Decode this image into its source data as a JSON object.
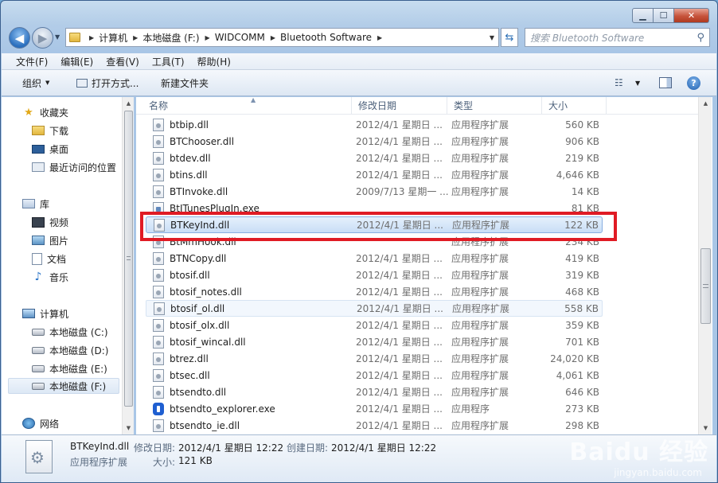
{
  "address": {
    "crumbs": [
      "计算机",
      "本地磁盘 (F:)",
      "WIDCOMM",
      "Bluetooth Software"
    ],
    "search_placeholder": "搜索 Bluetooth Software"
  },
  "menu": [
    "文件(F)",
    "编辑(E)",
    "查看(V)",
    "工具(T)",
    "帮助(H)"
  ],
  "toolbar": {
    "organize": "组织",
    "open_with": "打开方式...",
    "new_folder": "新建文件夹"
  },
  "sidebar": {
    "favorites": {
      "label": "收藏夹",
      "items": [
        "下载",
        "桌面",
        "最近访问的位置"
      ]
    },
    "libraries": {
      "label": "库",
      "items": [
        "视频",
        "图片",
        "文档",
        "音乐"
      ]
    },
    "computer": {
      "label": "计算机",
      "drives": [
        "本地磁盘 (C:)",
        "本地磁盘 (D:)",
        "本地磁盘 (E:)",
        "本地磁盘 (F:)"
      ]
    },
    "network": "网络"
  },
  "columns": {
    "name": "名称",
    "date": "修改日期",
    "type": "类型",
    "size": "大小"
  },
  "files": [
    {
      "name": "btbip.dll",
      "date": "2012/4/1 星期日 ...",
      "type": "应用程序扩展",
      "size": "560 KB",
      "icon": "dll"
    },
    {
      "name": "BTChooser.dll",
      "date": "2012/4/1 星期日 ...",
      "type": "应用程序扩展",
      "size": "906 KB",
      "icon": "dll"
    },
    {
      "name": "btdev.dll",
      "date": "2012/4/1 星期日 ...",
      "type": "应用程序扩展",
      "size": "219 KB",
      "icon": "dll"
    },
    {
      "name": "btins.dll",
      "date": "2012/4/1 星期日 ...",
      "type": "应用程序扩展",
      "size": "4,646 KB",
      "icon": "dll"
    },
    {
      "name": "BTInvoke.dll",
      "date": "2009/7/13 星期一 ...",
      "type": "应用程序扩展",
      "size": "14 KB",
      "icon": "dll"
    },
    {
      "name": "BtITunesPlugIn.exe",
      "date": "",
      "type": "",
      "size": "81 KB",
      "icon": "exe"
    },
    {
      "name": "BTKeyInd.dll",
      "date": "2012/4/1 星期日 ...",
      "type": "应用程序扩展",
      "size": "122 KB",
      "icon": "dll"
    },
    {
      "name": "BtMmHook.dll",
      "date": "",
      "type": "应用程序扩展",
      "size": "234 KB",
      "icon": "dll"
    },
    {
      "name": "BTNCopy.dll",
      "date": "2012/4/1 星期日 ...",
      "type": "应用程序扩展",
      "size": "419 KB",
      "icon": "dll"
    },
    {
      "name": "btosif.dll",
      "date": "2012/4/1 星期日 ...",
      "type": "应用程序扩展",
      "size": "319 KB",
      "icon": "dll"
    },
    {
      "name": "btosif_notes.dll",
      "date": "2012/4/1 星期日 ...",
      "type": "应用程序扩展",
      "size": "468 KB",
      "icon": "dll"
    },
    {
      "name": "btosif_ol.dll",
      "date": "2012/4/1 星期日 ...",
      "type": "应用程序扩展",
      "size": "558 KB",
      "icon": "dll"
    },
    {
      "name": "btosif_olx.dll",
      "date": "2012/4/1 星期日 ...",
      "type": "应用程序扩展",
      "size": "359 KB",
      "icon": "dll"
    },
    {
      "name": "btosif_wincal.dll",
      "date": "2012/4/1 星期日 ...",
      "type": "应用程序扩展",
      "size": "701 KB",
      "icon": "dll"
    },
    {
      "name": "btrez.dll",
      "date": "2012/4/1 星期日 ...",
      "type": "应用程序扩展",
      "size": "24,020 KB",
      "icon": "dll"
    },
    {
      "name": "btsec.dll",
      "date": "2012/4/1 星期日 ...",
      "type": "应用程序扩展",
      "size": "4,061 KB",
      "icon": "dll"
    },
    {
      "name": "btsendto.dll",
      "date": "2012/4/1 星期日 ...",
      "type": "应用程序扩展",
      "size": "646 KB",
      "icon": "dll"
    },
    {
      "name": "btsendto_explorer.exe",
      "date": "2012/4/1 星期日 ...",
      "type": "应用程序",
      "size": "273 KB",
      "icon": "bluetooth"
    },
    {
      "name": "btsendto_ie.dll",
      "date": "2012/4/1 星期日 ...",
      "type": "应用程序扩展",
      "size": "298 KB",
      "icon": "dll"
    }
  ],
  "details": {
    "name": "BTKeyInd.dll",
    "modified_label": "修改日期:",
    "modified": "2012/4/1 星期日 12:22",
    "created_label": "创建日期:",
    "created": "2012/4/1 星期日 12:22",
    "type": "应用程序扩展",
    "size_label": "大小:",
    "size": "121 KB"
  },
  "watermark": {
    "text": "Baidu 经验",
    "sub": "jingyan.baidu.com"
  },
  "colors": {
    "highlight": "#e01b24",
    "selection": "#c9def6"
  }
}
